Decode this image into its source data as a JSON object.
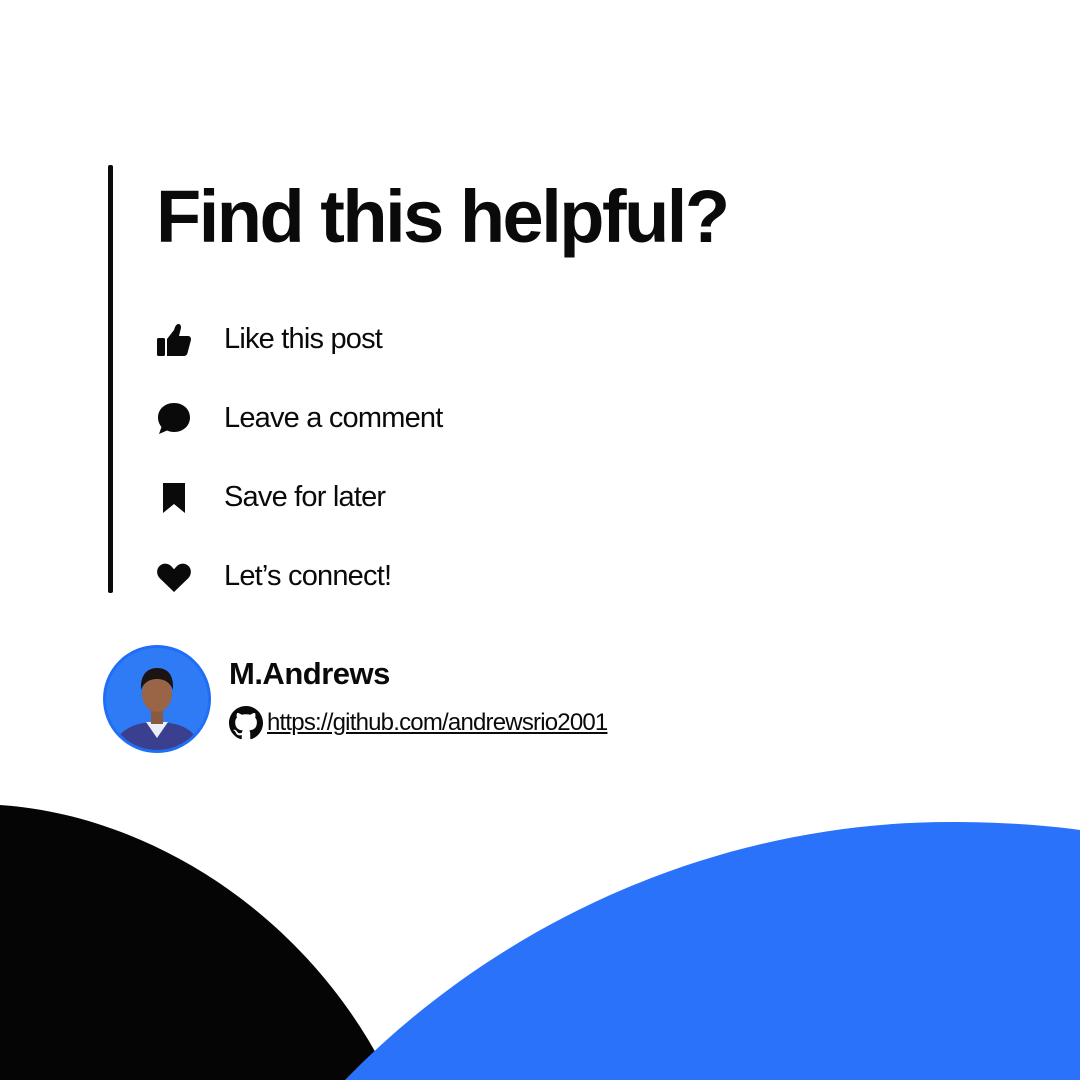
{
  "headline": "Find this helpful?",
  "actions": [
    {
      "label": "Like this post",
      "icon": "thumbs-up-icon"
    },
    {
      "label": "Leave a comment",
      "icon": "comment-icon"
    },
    {
      "label": "Save for later",
      "icon": "bookmark-icon"
    },
    {
      "label": "Let’s connect!",
      "icon": "heart-icon"
    }
  ],
  "author": {
    "name": "M.Andrews",
    "link": "https://github.com/andrewsrio2001",
    "link_icon": "github-icon"
  },
  "colors": {
    "text": "#0a0a0a",
    "accent_blue": "#2b72fb",
    "shape_black": "#050505",
    "background": "#ffffff"
  }
}
